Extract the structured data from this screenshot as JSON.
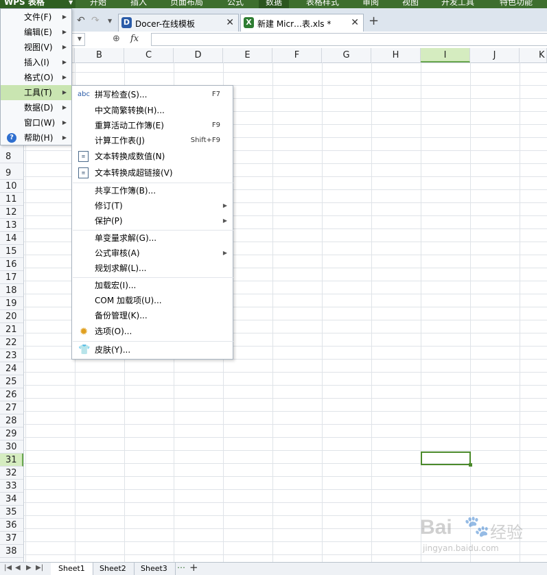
{
  "app": {
    "name": "WPS 表格"
  },
  "ribbon": {
    "tabs": [
      "开始",
      "插入",
      "页面布局",
      "公式",
      "数据",
      "表格样式",
      "审阅",
      "视图",
      "开发工具",
      "特色功能"
    ],
    "active": "数据"
  },
  "doc_tabs": [
    {
      "label": "Docer-在线模板"
    },
    {
      "label": "新建 Micr…表.xls *"
    }
  ],
  "formula_bar": {
    "fx_label": "fx"
  },
  "columns": [
    "B",
    "C",
    "D",
    "E",
    "F",
    "G",
    "H",
    "I",
    "J",
    "K"
  ],
  "selected_column": "I",
  "rows": [
    "8",
    "9",
    "10",
    "11",
    "12",
    "13",
    "14",
    "15",
    "16",
    "17",
    "18",
    "19",
    "20",
    "21",
    "22",
    "23",
    "24",
    "25",
    "26",
    "27",
    "28",
    "29",
    "30",
    "31",
    "32",
    "33",
    "34",
    "35",
    "36",
    "37",
    "38"
  ],
  "selected_row": "31",
  "main_menu": [
    {
      "label": "文件(F)"
    },
    {
      "label": "编辑(E)"
    },
    {
      "label": "视图(V)"
    },
    {
      "label": "插入(I)"
    },
    {
      "label": "格式(O)"
    },
    {
      "label": "工具(T)"
    },
    {
      "label": "数据(D)"
    },
    {
      "label": "窗口(W)"
    },
    {
      "label": "帮助(H)"
    }
  ],
  "tools_menu": [
    {
      "label": "拼写检查(S)...",
      "shortcut": "F7"
    },
    {
      "label": "中文简繁转换(H)..."
    },
    {
      "label": "重算活动工作簿(E)",
      "shortcut": "F9"
    },
    {
      "label": "计算工作表(J)",
      "shortcut": "Shift+F9"
    },
    {
      "label": "文本转换成数值(N)"
    },
    {
      "label": "文本转换成超链接(V)"
    },
    {
      "label": "共享工作簿(B)..."
    },
    {
      "label": "修订(T)"
    },
    {
      "label": "保护(P)"
    },
    {
      "label": "单变量求解(G)..."
    },
    {
      "label": "公式审核(A)"
    },
    {
      "label": "规划求解(L)..."
    },
    {
      "label": "加载宏(I)..."
    },
    {
      "label": "COM 加载项(U)..."
    },
    {
      "label": "备份管理(K)..."
    },
    {
      "label": "选项(O)..."
    },
    {
      "label": "皮肤(Y)..."
    }
  ],
  "icon_text": {
    "spell": "abc"
  },
  "sheets": [
    "Sheet1",
    "Sheet2",
    "Sheet3"
  ],
  "watermark": {
    "brand": "Bai",
    "brand2": "经验",
    "url": "jingyan.baidu.com"
  },
  "colors": {
    "accent": "#3d6e2e",
    "highlight": "#c9e5b1",
    "active_cell": "#4b8a2b"
  }
}
